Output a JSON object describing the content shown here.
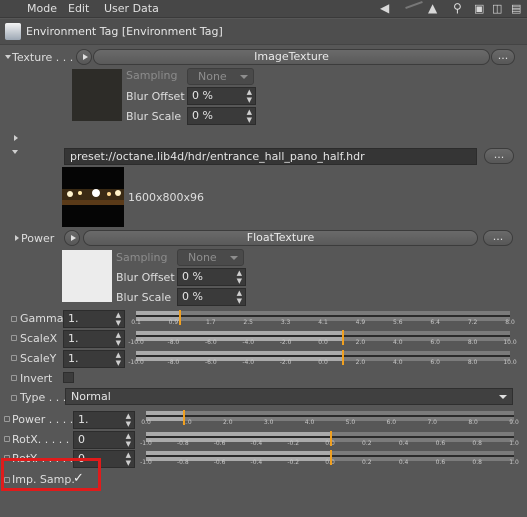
{
  "menubar": {
    "mode": "Mode",
    "edit": "Edit",
    "user_data": "User Data"
  },
  "title": "Environment Tag [Environment Tag]",
  "texture": {
    "label": "Texture . . .",
    "shader_button": "ImageTexture",
    "sampling_label": "Sampling",
    "sampling_value": "None",
    "blur_offset_label": "Blur Offset",
    "blur_offset_value": "0 %",
    "blur_scale_label": "Blur Scale",
    "blur_scale_value": "0 %",
    "file_path": "preset://octane.lib4d/hdr/entrance_hall_pano_half.hdr",
    "file_button": "...",
    "resolution": "1600x800x96"
  },
  "power": {
    "label": "Power",
    "shader_button": "FloatTexture",
    "more_button": "...",
    "sampling_label": "Sampling",
    "sampling_value": "None",
    "blur_offset_label": "Blur Offset",
    "blur_offset_value": "0 %",
    "blur_scale_label": "Blur Scale",
    "blur_scale_value": "0 %"
  },
  "params": {
    "gamma": {
      "label": "Gamma",
      "value": "1.",
      "ticks": [
        "0.1",
        "0.9",
        "1.7",
        "2.5",
        "3.3",
        "4.1",
        "4.9",
        "5.6",
        "6.4",
        "7.2",
        "8.0"
      ],
      "min": 0.1,
      "max": 8.0,
      "level": 1.0
    },
    "scalex": {
      "label": "ScaleX",
      "value": "1.",
      "ticks": [
        "-10.0",
        "-8.0",
        "-6.0",
        "-4.0",
        "-2.0",
        "0.0",
        "2.0",
        "4.0",
        "6.0",
        "8.0",
        "10.0"
      ],
      "min": -10,
      "max": 10,
      "level": 1.0
    },
    "scaley": {
      "label": "ScaleY",
      "value": "1.",
      "ticks": [
        "-10.0",
        "-8.0",
        "-6.0",
        "-4.0",
        "-2.0",
        "0.0",
        "2.0",
        "4.0",
        "6.0",
        "8.0",
        "10.0"
      ],
      "min": -10,
      "max": 10,
      "level": 1.0
    },
    "invert_label": "Invert",
    "type_label": "Type . . .",
    "type_value": "Normal",
    "power2": {
      "label": "Power . . . .",
      "value": "1.",
      "ticks": [
        "0.0",
        "1.0",
        "2.0",
        "3.0",
        "4.0",
        "5.0",
        "6.0",
        "7.0",
        "8.0",
        "9.0"
      ],
      "min": 0,
      "max": 10,
      "level": 1.0
    },
    "rotx": {
      "label": "RotX. . . . . .",
      "value": "0",
      "ticks": [
        "-1.0",
        "-0.8",
        "-0.6",
        "-0.4",
        "-0.2",
        "0.0",
        "0.2",
        "0.4",
        "0.6",
        "0.8",
        "1.0"
      ],
      "min": -1,
      "max": 1,
      "level": 0
    },
    "roty": {
      "label": "RotY. . . . . .",
      "value": "0",
      "ticks": [
        "-1.0",
        "-0.8",
        "-0.6",
        "-0.4",
        "-0.2",
        "0.0",
        "0.2",
        "0.4",
        "0.6",
        "0.8",
        "1.0"
      ],
      "min": -1,
      "max": 1,
      "level": 0
    },
    "imp_samp_label": "Imp. Samp.",
    "imp_samp_check": "✓"
  },
  "colors": {
    "highlight": "#e01b1b",
    "knob": "#f0a020"
  }
}
